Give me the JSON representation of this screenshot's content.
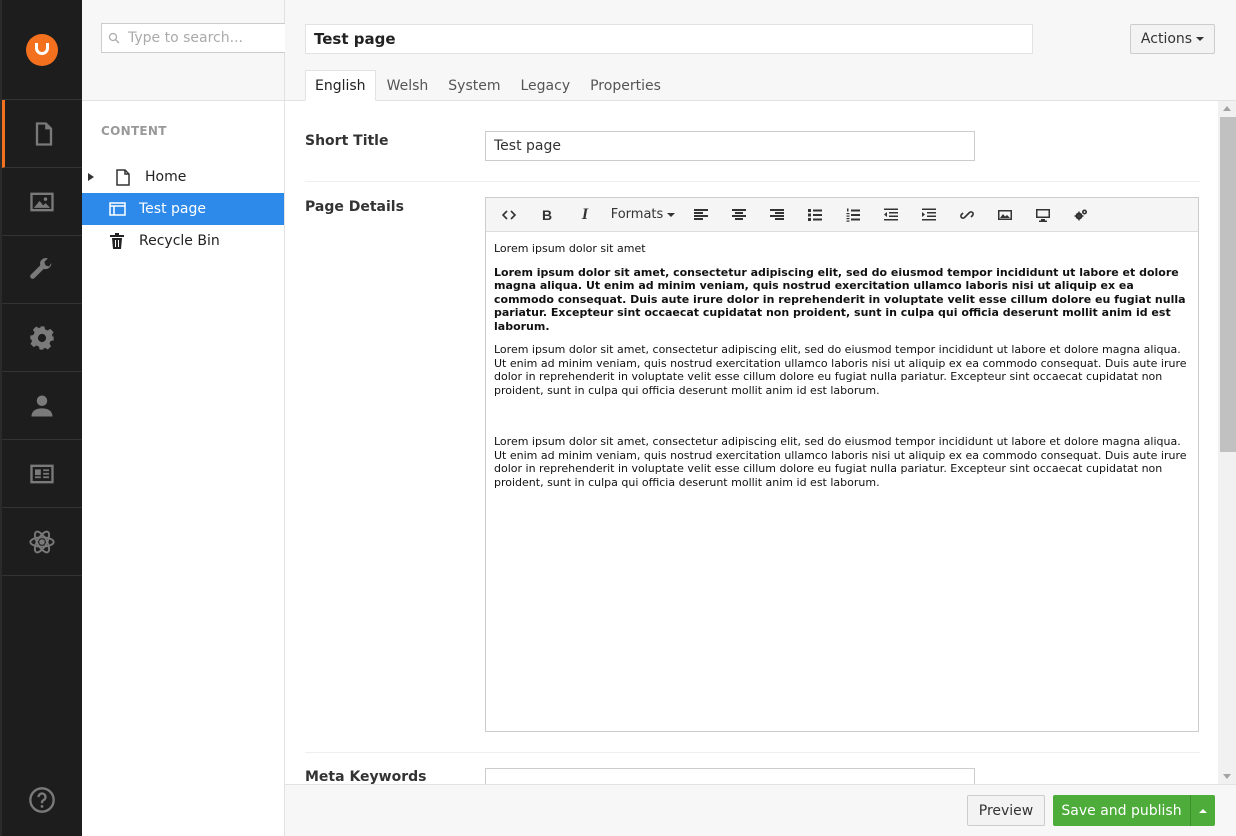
{
  "colors": {
    "accent": "#f3701e",
    "selected": "#2e8aea",
    "publish": "#4eac3a"
  },
  "appbar": {
    "sections": [
      {
        "name": "content",
        "icon": "document-icon"
      },
      {
        "name": "media",
        "icon": "image-icon"
      },
      {
        "name": "settings",
        "icon": "wrench-icon"
      },
      {
        "name": "developer",
        "icon": "gear-icon"
      },
      {
        "name": "users",
        "icon": "user-icon"
      },
      {
        "name": "members",
        "icon": "id-card-icon"
      },
      {
        "name": "forms",
        "icon": "atom-icon"
      }
    ],
    "help_icon": "help-icon"
  },
  "tree": {
    "search_placeholder": "Type to search...",
    "section_title": "CONTENT",
    "nodes": [
      {
        "label": "Home",
        "icon": "document-icon"
      },
      {
        "label": "Test page",
        "icon": "layout-icon"
      },
      {
        "label": "Recycle Bin",
        "icon": "trash-icon"
      }
    ]
  },
  "header": {
    "page_name": "Test page",
    "actions_label": "Actions",
    "tabs": [
      "English",
      "Welsh",
      "System",
      "Legacy",
      "Properties"
    ]
  },
  "form": {
    "short_title_label": "Short Title",
    "short_title_value": "Test page",
    "page_details_label": "Page Details",
    "meta_keywords_label": "Meta Keywords",
    "meta_keywords_value": ""
  },
  "editor": {
    "formats_label": "Formats",
    "paragraphs": [
      "Lorem ipsum dolor sit amet",
      "Lorem ipsum dolor sit amet, consectetur adipiscing elit, sed do eiusmod tempor incididunt ut labore et dolore magna aliqua. Ut enim ad minim veniam, quis nostrud exercitation ullamco laboris nisi ut aliquip ex ea commodo consequat. Duis aute irure dolor in reprehenderit in voluptate velit esse cillum dolore eu fugiat nulla pariatur. Excepteur sint occaecat cupidatat non proident, sunt in culpa qui officia deserunt mollit anim id est laborum.",
      "Lorem ipsum dolor sit amet, consectetur adipiscing elit, sed do eiusmod tempor incididunt ut labore et dolore magna aliqua. Ut enim ad minim veniam, quis nostrud exercitation ullamco laboris nisi ut aliquip ex ea commodo consequat. Duis aute irure dolor in reprehenderit in voluptate velit esse cillum dolore eu fugiat nulla pariatur. Excepteur sint occaecat cupidatat non proident, sunt in culpa qui officia deserunt mollit anim id est laborum.",
      "Lorem ipsum dolor sit amet, consectetur adipiscing elit, sed do eiusmod tempor incididunt ut labore et dolore magna aliqua. Ut enim ad minim veniam, quis nostrud exercitation ullamco laboris nisi ut aliquip ex ea commodo consequat. Duis aute irure dolor in reprehenderit in voluptate velit esse cillum dolore eu fugiat nulla pariatur. Excepteur sint occaecat cupidatat non proident, sunt in culpa qui officia deserunt mollit anim id est laborum."
    ]
  },
  "footer": {
    "preview_label": "Preview",
    "publish_label": "Save and publish"
  }
}
